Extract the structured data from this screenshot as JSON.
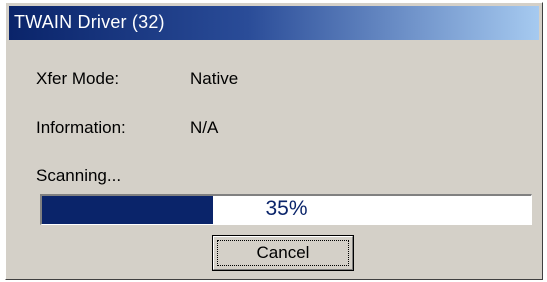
{
  "window": {
    "title": "TWAIN Driver (32)"
  },
  "fields": [
    {
      "label": "Xfer Mode:",
      "value": "Native"
    },
    {
      "label": "Information:",
      "value": "N/A"
    }
  ],
  "status": {
    "text": "Scanning..."
  },
  "progress": {
    "percent": 35,
    "label": "35%"
  },
  "buttons": {
    "cancel_label": "Cancel"
  },
  "colors": {
    "title_gradient_start": "#0a246a",
    "title_gradient_end": "#a6caf0",
    "progress_fill": "#0a246a",
    "dialog_face": "#d4d0c8"
  }
}
